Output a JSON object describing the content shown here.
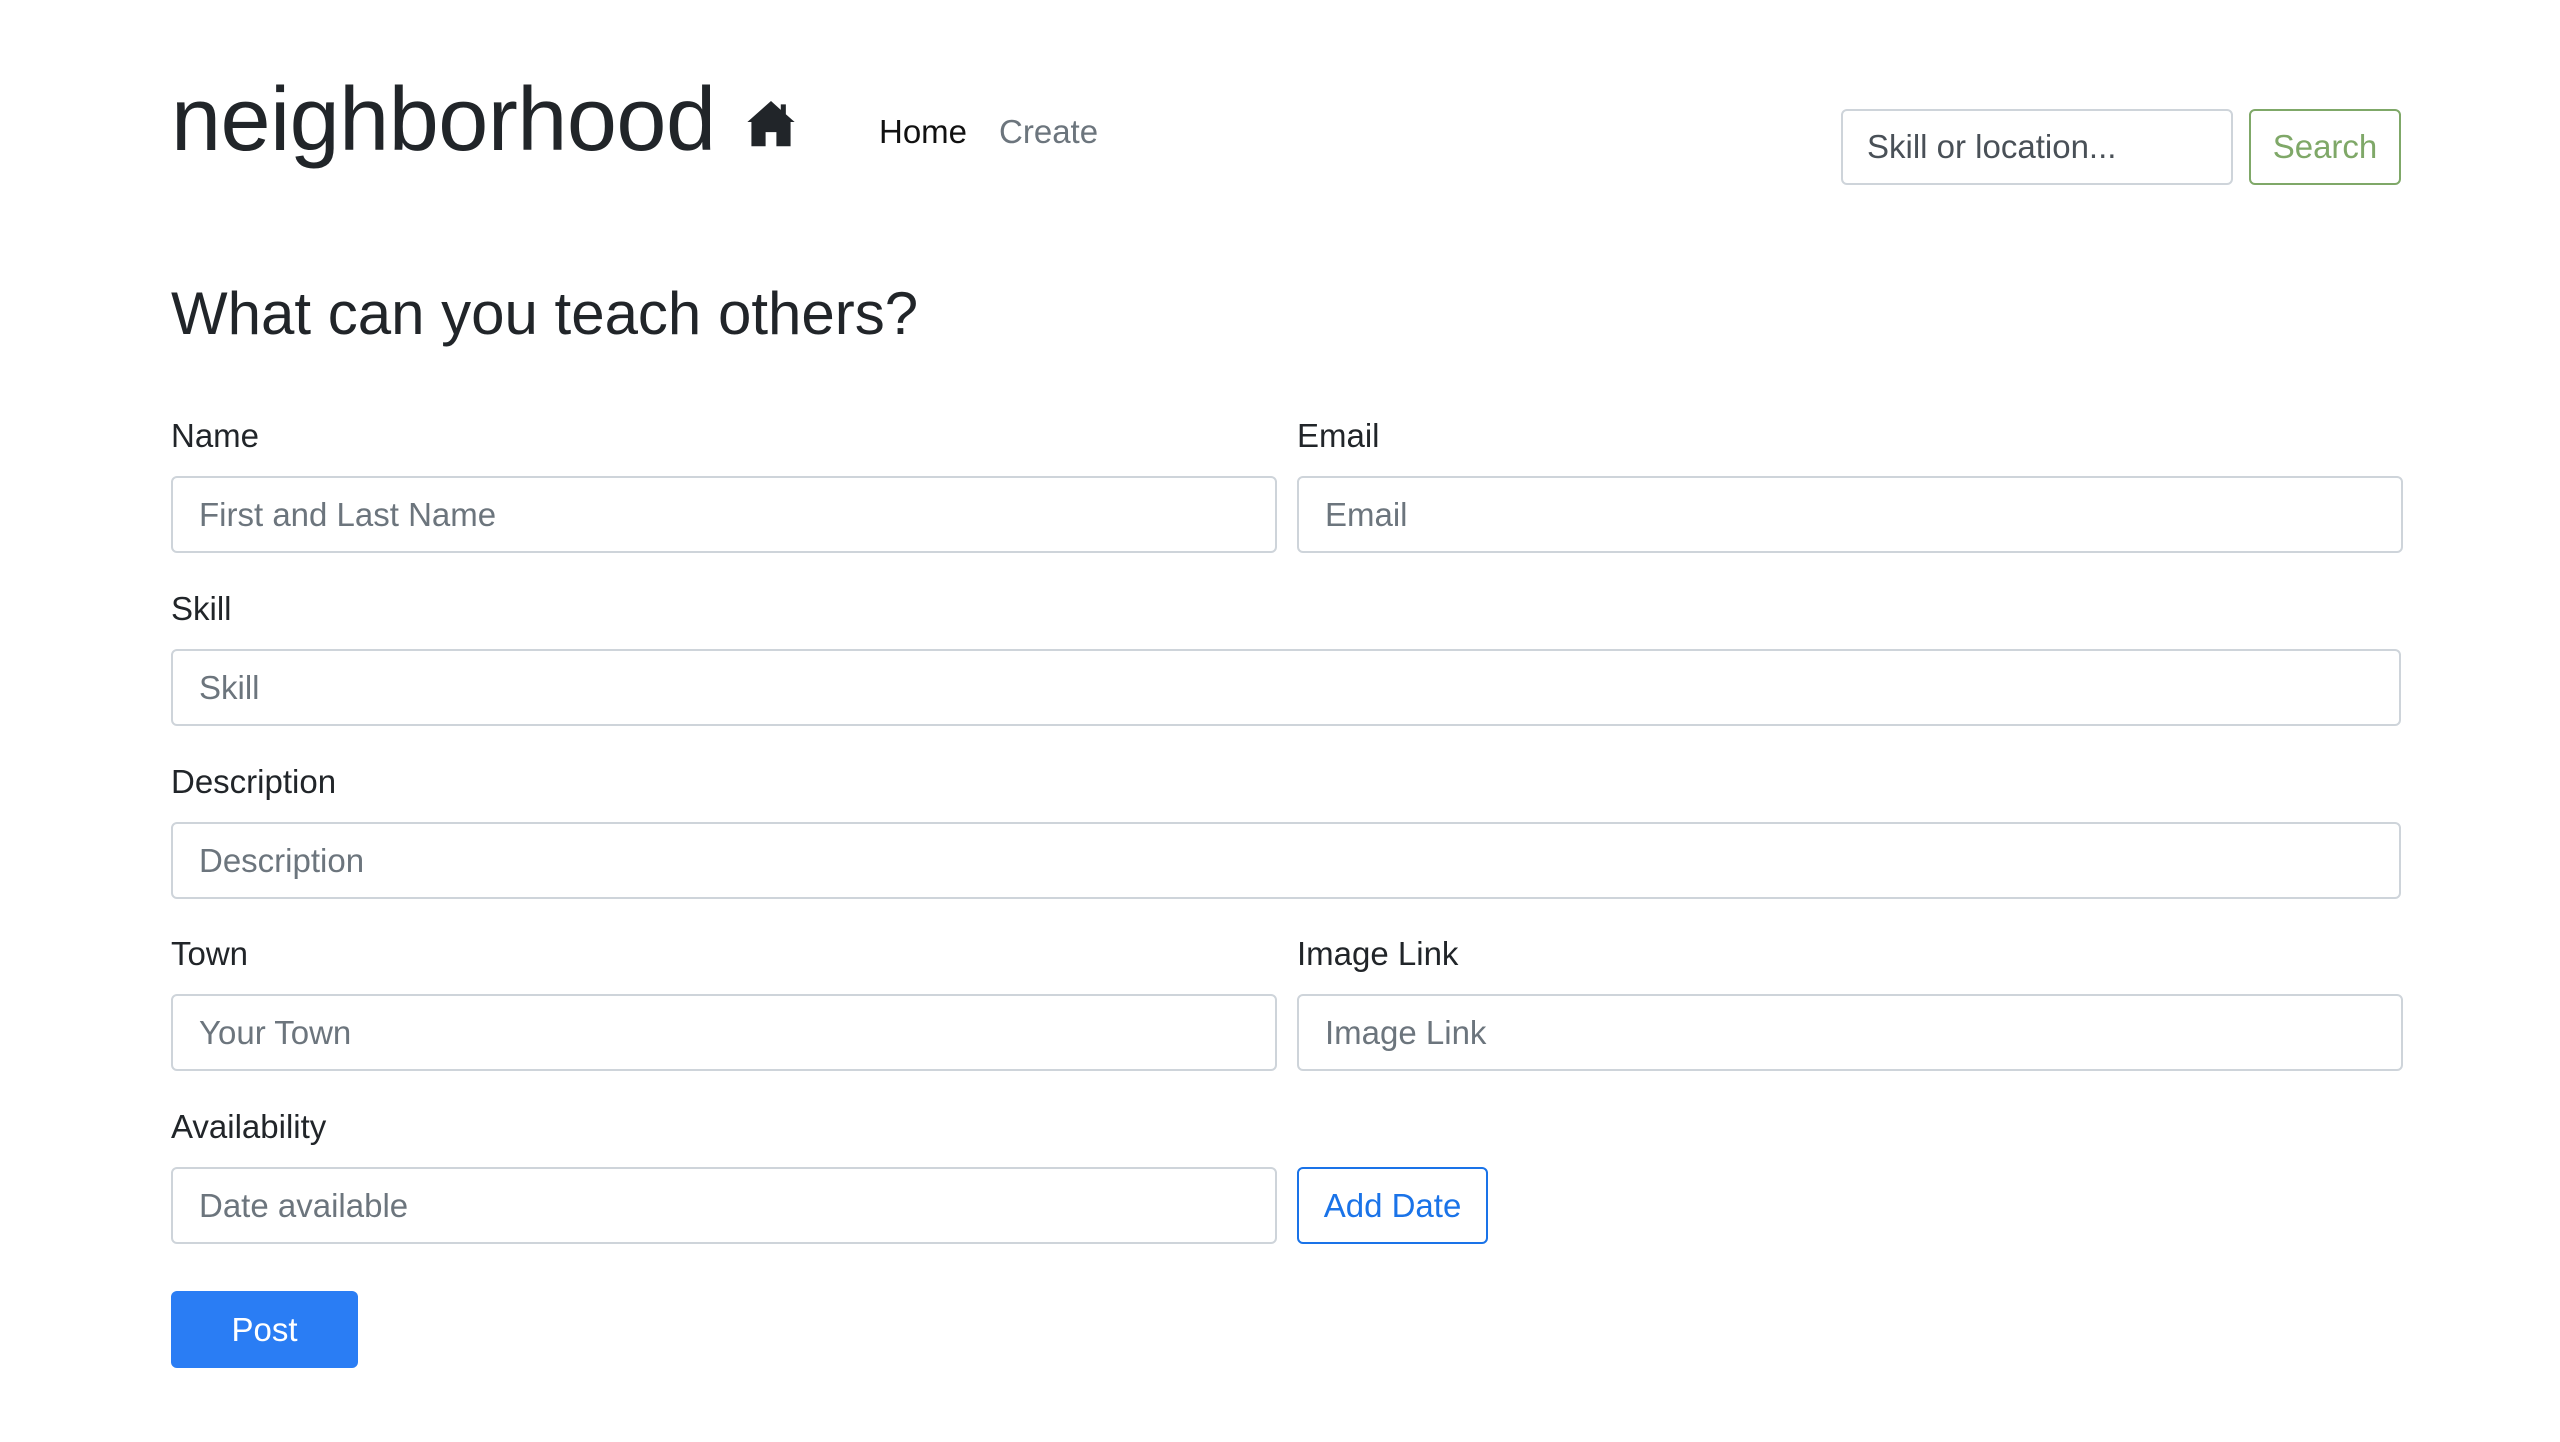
{
  "header": {
    "brand": "neighborhood",
    "brand_icon": "home-icon",
    "nav": {
      "home": "Home",
      "create": "Create"
    },
    "search": {
      "placeholder": "Skill or location...",
      "button_label": "Search"
    }
  },
  "form": {
    "title": "What can you teach others?",
    "name": {
      "label": "Name",
      "placeholder": "First and Last Name",
      "value": ""
    },
    "email": {
      "label": "Email",
      "placeholder": "Email",
      "value": ""
    },
    "skill": {
      "label": "Skill",
      "placeholder": "Skill",
      "value": ""
    },
    "description": {
      "label": "Description",
      "placeholder": "Description",
      "value": ""
    },
    "town": {
      "label": "Town",
      "placeholder": "Your Town",
      "value": ""
    },
    "image_link": {
      "label": "Image Link",
      "placeholder": "Image Link",
      "value": ""
    },
    "availability": {
      "label": "Availability",
      "placeholder": "Date available",
      "value": ""
    },
    "add_date_label": "Add Date",
    "post_label": "Post"
  },
  "colors": {
    "text": "#212529",
    "muted": "#6c757d",
    "search_outline": "#7fa868",
    "primary": "#2a7df4",
    "primary_outline": "#1a73e8",
    "border": "#ced4da"
  }
}
